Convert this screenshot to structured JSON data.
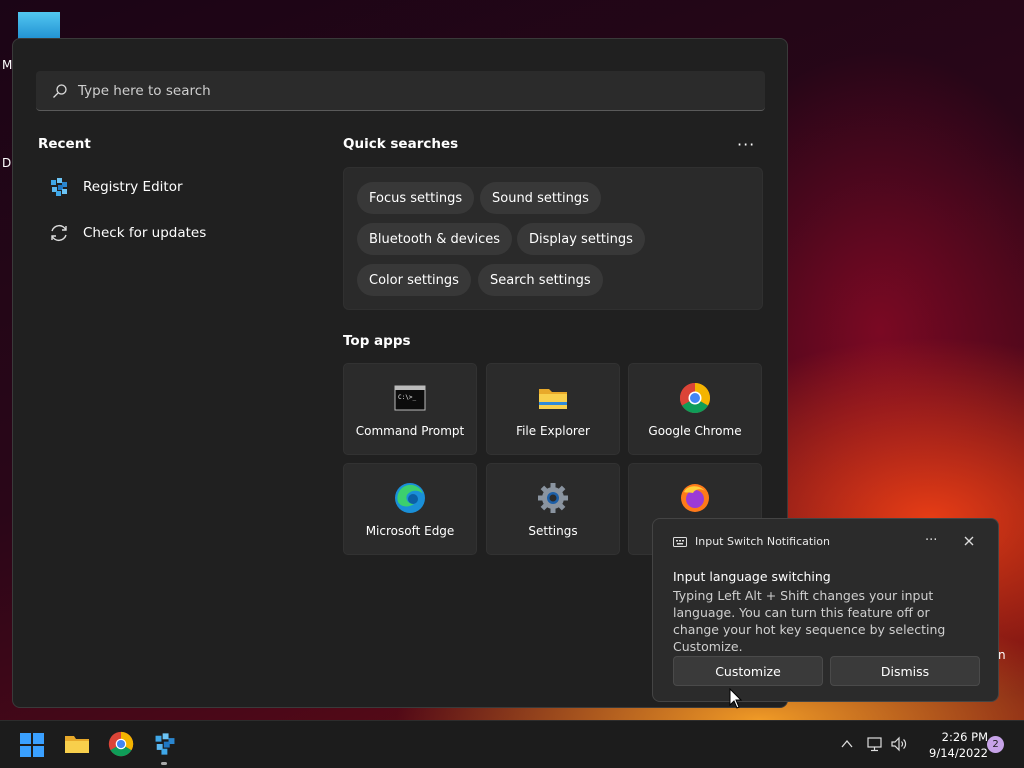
{
  "desktop": {
    "label_m": "M",
    "label_d": "D",
    "label_n": "n"
  },
  "search": {
    "placeholder": "Type here to search"
  },
  "recent": {
    "title": "Recent",
    "items": [
      {
        "label": "Registry Editor",
        "icon": "registry-editor-icon"
      },
      {
        "label": "Check for updates",
        "icon": "refresh-icon"
      }
    ]
  },
  "quick_searches": {
    "title": "Quick searches",
    "more": "···",
    "chips": [
      "Focus settings",
      "Sound settings",
      "Bluetooth & devices",
      "Display settings",
      "Color settings",
      "Search settings"
    ]
  },
  "top_apps": {
    "title": "Top apps",
    "tiles": [
      {
        "label": "Command Prompt",
        "icon": "command-prompt-icon"
      },
      {
        "label": "File Explorer",
        "icon": "folder-icon"
      },
      {
        "label": "Google Chrome",
        "icon": "chrome-icon"
      },
      {
        "label": "Microsoft Edge",
        "icon": "edge-icon"
      },
      {
        "label": "Settings",
        "icon": "gear-icon"
      },
      {
        "label": "",
        "icon": "firefox-icon"
      }
    ]
  },
  "notification": {
    "app": "Input Switch Notification",
    "more": "···",
    "title": "Input language switching",
    "body": "Typing Left Alt + Shift changes your input language. You can turn this feature off or change your hot key sequence by selecting Customize.",
    "customize": "Customize",
    "dismiss": "Dismiss"
  },
  "taskbar": {
    "time": "2:26 PM",
    "date": "9/14/2022",
    "badge": "2"
  },
  "colors": {
    "accent": "#0078d4",
    "badge": "#c7a3e8",
    "panel": "#202020"
  }
}
